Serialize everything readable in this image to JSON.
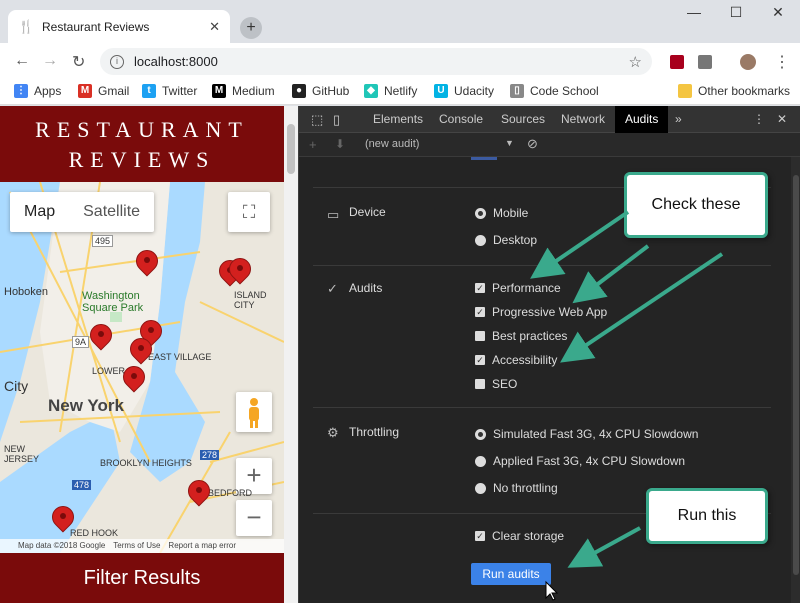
{
  "browser": {
    "tab_title": "Restaurant Reviews",
    "new_tab": "+",
    "controls": {
      "minimize": "—",
      "maximize": "☐",
      "close": "✕"
    },
    "url": "localhost:8000"
  },
  "bookmarks": [
    {
      "label": "Apps",
      "icon": "apps-icon",
      "color": "#4285f4"
    },
    {
      "label": "Gmail",
      "icon": "gmail-icon",
      "color": "#d93025"
    },
    {
      "label": "Twitter",
      "icon": "twitter-icon",
      "color": "#1da1f2"
    },
    {
      "label": "Medium",
      "icon": "medium-icon",
      "color": "#000000"
    },
    {
      "label": "GitHub",
      "icon": "github-icon",
      "color": "#222222"
    },
    {
      "label": "Netlify",
      "icon": "netlify-icon",
      "color": "#20c6b7"
    },
    {
      "label": "Udacity",
      "icon": "udacity-icon",
      "color": "#02b3e4"
    },
    {
      "label": "Code School",
      "icon": "page-icon",
      "color": "#888888"
    }
  ],
  "bookmarks_other": "Other bookmarks",
  "site": {
    "title_line1": "RESTAURANT",
    "title_line2": "REVIEWS",
    "filter_label": "Filter Results",
    "header_color": "#7a0b0b"
  },
  "map": {
    "type_map": "Map",
    "type_satellite": "Satellite",
    "zoom_in": "+",
    "zoom_out": "−",
    "labels": {
      "hoboken": "Hoboken",
      "washington_sq": "Washington Square Park",
      "east_village": "EAST VILLAGE",
      "lower": "LOWER",
      "city": "City",
      "new_york": "New York",
      "brooklyn_heights": "BROOKLYN HEIGHTS",
      "new_jersey": "NEW JERSEY",
      "red_hook": "RED HOOK",
      "island_city": "ISLAND CITY",
      "bedford": "BEDFORD",
      "route_495": "495",
      "route_9a": "9A",
      "route_478": "478",
      "route_278": "278"
    },
    "footer": [
      "Map data ©2018 Google",
      "Terms of Use",
      "Report a map error"
    ]
  },
  "devtools": {
    "tabs": [
      "Elements",
      "Console",
      "Sources",
      "Network",
      "Audits"
    ],
    "active_tab": "Audits",
    "more": "»",
    "menu": "⋮",
    "close": "✕",
    "audit_select": "(new audit)",
    "device": {
      "title": "Device",
      "options": [
        {
          "label": "Mobile",
          "selected": true
        },
        {
          "label": "Desktop",
          "selected": false
        }
      ]
    },
    "audits": {
      "title": "Audits",
      "options": [
        {
          "label": "Performance",
          "checked": true
        },
        {
          "label": "Progressive Web App",
          "checked": true
        },
        {
          "label": "Best practices",
          "checked": false
        },
        {
          "label": "Accessibility",
          "checked": true
        },
        {
          "label": "SEO",
          "checked": false
        }
      ]
    },
    "throttling": {
      "title": "Throttling",
      "options": [
        {
          "label": "Simulated Fast 3G, 4x CPU Slowdown",
          "selected": true
        },
        {
          "label": "Applied Fast 3G, 4x CPU Slowdown",
          "selected": false
        },
        {
          "label": "No throttling",
          "selected": false
        }
      ]
    },
    "clear_storage": {
      "label": "Clear storage",
      "checked": true
    },
    "run_button": "Run audits"
  },
  "callouts": {
    "check_these": "Check these",
    "run_this": "Run this"
  },
  "accent_color": "#3aa98c"
}
